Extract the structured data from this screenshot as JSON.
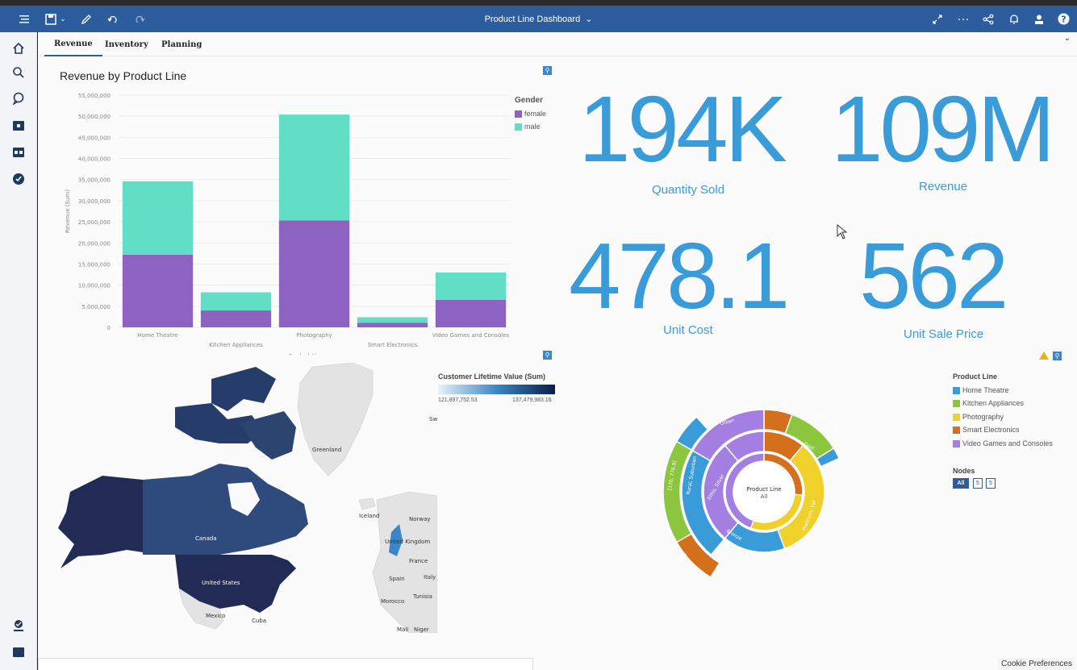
{
  "topbar": {
    "title": "Product Line Dashboard",
    "icons": [
      "menu-icon",
      "save-icon",
      "chevron-down-icon",
      "pencil-icon",
      "undo-icon",
      "redo-icon",
      "expand-icon",
      "more-icon",
      "share-icon",
      "bell-icon",
      "user-icon",
      "help-icon"
    ]
  },
  "tabs": [
    "Revenue",
    "Inventory",
    "Planning"
  ],
  "sidebar": {
    "icons": [
      "home-icon",
      "search-icon",
      "chat-icon",
      "folder-icon",
      "team-folder-icon",
      "recent-icon",
      "user-badge-icon",
      "panel-icon"
    ]
  },
  "bar_chart": {
    "title": "Revenue by Product Line",
    "legend_title": "Gender",
    "xlabel": "Product Line",
    "ylabel": "Revenue (Sum)"
  },
  "chart_data": {
    "type": "bar",
    "stacked": true,
    "title": "Revenue by Product Line",
    "xlabel": "Product Line",
    "ylabel": "Revenue (Sum)",
    "categories": [
      "Home Theatre",
      "Kitchen Appliances",
      "Photography",
      "Smart Electronics",
      "Video Games and Consoles"
    ],
    "series": [
      {
        "name": "female",
        "values": [
          17200000,
          4000000,
          25300000,
          1100000,
          6500000
        ],
        "color": "#8e62c0"
      },
      {
        "name": "male",
        "values": [
          17400000,
          4300000,
          25100000,
          1300000,
          6500000
        ],
        "color": "#62ddc6"
      }
    ],
    "ylim": [
      0,
      55000000
    ],
    "yticks": [
      "0",
      "5,000,000",
      "10,000,000",
      "15,000,000",
      "20,000,000",
      "25,000,000",
      "30,000,000",
      "35,000,000",
      "40,000,000",
      "45,000,000",
      "50,000,000",
      "55,000,000"
    ],
    "grid": true,
    "legend_position": "top-right"
  },
  "kpis": [
    {
      "value": "194K",
      "label": "Quantity Sold"
    },
    {
      "value": "109M",
      "label": "Revenue"
    },
    {
      "value": "478.1",
      "label": "Unit Cost"
    },
    {
      "value": "562",
      "label": "Unit Sale Price"
    }
  ],
  "map": {
    "legend_title": "Customer Lifetime Value (Sum)",
    "legend_min": "121,897,752.53",
    "legend_max": "137,479,983.16",
    "labels": [
      "Greenland",
      "Iceland",
      "Canada",
      "United States",
      "Norway",
      "United Kingdom",
      "France",
      "Spain",
      "Italy",
      "Morocco",
      "Tunisia",
      "Mexico",
      "Cuba",
      "Mali",
      "Niger",
      "Sw"
    ]
  },
  "sunburst": {
    "center_title": "Product Line",
    "center_sub": "All",
    "legend_title": "Product Line",
    "legend": [
      {
        "name": "Home Theatre",
        "color": "#3a9bd9"
      },
      {
        "name": "Kitchen Appliances",
        "color": "#8cc63f"
      },
      {
        "name": "Photography",
        "color": "#f0d02a"
      },
      {
        "name": "Smart Electronics",
        "color": "#d46f1c"
      },
      {
        "name": "Video Games and Consoles",
        "color": "#a27fe0"
      }
    ],
    "nodes_title": "Nodes",
    "nodes_buttons": [
      "All",
      "5",
      "5"
    ],
    "ring_labels": [
      "Urban",
      "Gold",
      "Platinum, VIP",
      "Bronze",
      "Ethis, Silver",
      "Rural, Suburban",
      "[170, 776.8]",
      "< 170",
      "[170, 776.8]",
      "< 170",
      "< 170",
      "776.8"
    ]
  },
  "cookie": "Cookie Preferences"
}
